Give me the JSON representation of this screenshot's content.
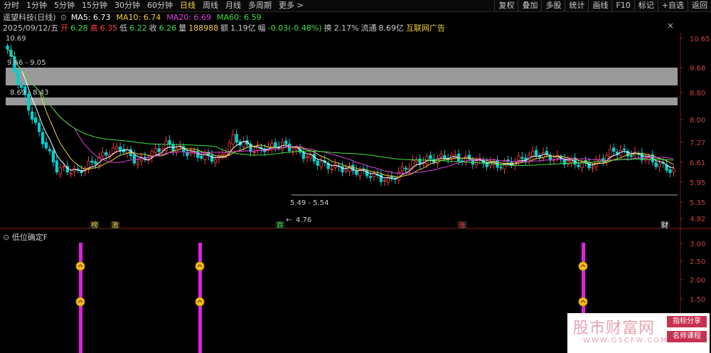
{
  "periods": [
    "分时",
    "1分钟",
    "5分钟",
    "15分钟",
    "30分钟",
    "60分钟",
    "日线",
    "周线",
    "月线",
    "多周期",
    "更多 >"
  ],
  "active_period": "日线",
  "tools": [
    "复权",
    "叠加",
    "多股",
    "统计",
    "画线",
    "F10",
    "标记",
    "+自选",
    "返回"
  ],
  "stock": {
    "name": "遥望科技(日线)",
    "dropdown_glyph": "⊙"
  },
  "ma": [
    {
      "label": "MA5: 6.73",
      "color": "#ffffff"
    },
    {
      "label": "MA10: 6.74",
      "color": "#f2d13e"
    },
    {
      "label": "MA20: 6.69",
      "color": "#e040e0"
    },
    {
      "label": "MA60: 6.59",
      "color": "#40e040"
    }
  ],
  "quote": [
    {
      "text": "2025/09/12/五",
      "color": "#cccccc"
    },
    {
      "text": "开",
      "color": "#ff4040"
    },
    {
      "text": "6.28",
      "color": "#40e040"
    },
    {
      "text": "高",
      "color": "#ff4040"
    },
    {
      "text": "6.35",
      "color": "#ff4040"
    },
    {
      "text": "低",
      "color": "#cccccc"
    },
    {
      "text": "6.22",
      "color": "#40e040"
    },
    {
      "text": "收",
      "color": "#cccccc"
    },
    {
      "text": "6.26",
      "color": "#40e040"
    },
    {
      "text": "量",
      "color": "#cccccc"
    },
    {
      "text": "188988",
      "color": "#f2d13e"
    },
    {
      "text": "额",
      "color": "#cccccc"
    },
    {
      "text": "1.19亿",
      "color": "#cccccc"
    },
    {
      "text": "幅",
      "color": "#cccccc"
    },
    {
      "text": "-0.03(-0.48%)",
      "color": "#40e040"
    },
    {
      "text": "换",
      "color": "#cccccc"
    },
    {
      "text": "2.17%",
      "color": "#cccccc"
    },
    {
      "text": "流通",
      "color": "#cccccc"
    },
    {
      "text": "8.69亿",
      "color": "#cccccc"
    },
    {
      "text": "互联网广告",
      "color": "#f2d13e"
    }
  ],
  "close_icon": "×",
  "price_axis": [
    "10.65",
    "9.68",
    "8.80",
    "8.00",
    "7.27",
    "6.61",
    "5.95",
    "5.35",
    "4.82"
  ],
  "annotations": {
    "high": "10.69",
    "zone1": "9.66 - 9.05",
    "zone2": "8.69 - 8.43",
    "zone3": "5.49 - 5.54",
    "low": "4.76"
  },
  "event_markers": [
    {
      "text": "榜",
      "color": "#f2d13e"
    },
    {
      "text": "激",
      "color": "#f2d13e"
    },
    {
      "text": "跌",
      "color": "#40e040"
    },
    {
      "text": "涨",
      "color": "#ff4040"
    },
    {
      "text": "财",
      "color": "#ffffff"
    }
  ],
  "indicator": {
    "title": "低位确定F",
    "icon": "⊙",
    "axis": [
      "3.00",
      "2.50",
      "2.00",
      "1.50"
    ]
  },
  "chart_data": {
    "type": "candlestick",
    "title": "遥望科技(日线)",
    "ma_lines": [
      "MA5",
      "MA10",
      "MA20",
      "MA60"
    ],
    "last_close": 6.26,
    "range_high": 10.69,
    "range_low": 4.76,
    "indicator_signals": 3
  },
  "watermark": {
    "title": "股市财富网",
    "url": "WWW.GSCFW.COM",
    "badge1": "指标分享",
    "badge2": "名师课程"
  }
}
